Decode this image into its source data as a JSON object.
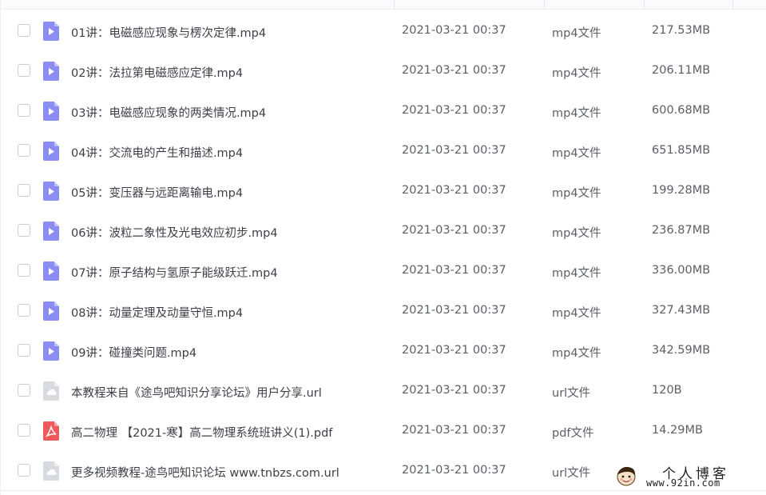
{
  "files": [
    {
      "name": "01讲：电磁感应现象与楞次定律.mp4",
      "date": "2021-03-21 00:37",
      "type": "mp4文件",
      "size": "217.53MB",
      "icon": "video-file-icon"
    },
    {
      "name": "02讲：法拉第电磁感应定律.mp4",
      "date": "2021-03-21 00:37",
      "type": "mp4文件",
      "size": "206.11MB",
      "icon": "video-file-icon"
    },
    {
      "name": "03讲：电磁感应现象的两类情况.mp4",
      "date": "2021-03-21 00:37",
      "type": "mp4文件",
      "size": "600.68MB",
      "icon": "video-file-icon"
    },
    {
      "name": "04讲：交流电的产生和描述.mp4",
      "date": "2021-03-21 00:37",
      "type": "mp4文件",
      "size": "651.85MB",
      "icon": "video-file-icon"
    },
    {
      "name": "05讲：变压器与远距离输电.mp4",
      "date": "2021-03-21 00:37",
      "type": "mp4文件",
      "size": "199.28MB",
      "icon": "video-file-icon"
    },
    {
      "name": "06讲：波粒二象性及光电效应初步.mp4",
      "date": "2021-03-21 00:37",
      "type": "mp4文件",
      "size": "236.87MB",
      "icon": "video-file-icon"
    },
    {
      "name": "07讲：原子结构与氢原子能级跃迁.mp4",
      "date": "2021-03-21 00:37",
      "type": "mp4文件",
      "size": "336.00MB",
      "icon": "video-file-icon"
    },
    {
      "name": "08讲：动量定理及动量守恒.mp4",
      "date": "2021-03-21 00:37",
      "type": "mp4文件",
      "size": "327.43MB",
      "icon": "video-file-icon"
    },
    {
      "name": "09讲：碰撞类问题.mp4",
      "date": "2021-03-21 00:37",
      "type": "mp4文件",
      "size": "342.59MB",
      "icon": "video-file-icon"
    },
    {
      "name": "本教程来自《途鸟吧知识分享论坛》用户分享.url",
      "date": "2021-03-21 00:37",
      "type": "url文件",
      "size": "120B",
      "icon": "link-file-icon"
    },
    {
      "name": "高二物理 【2021-寒】高二物理系统班讲义(1).pdf",
      "date": "2021-03-21 00:37",
      "type": "pdf文件",
      "size": "14.29MB",
      "icon": "pdf-file-icon"
    },
    {
      "name": "更多视频教程-途鸟吧知识论坛 www.tnbzs.com.url",
      "date": "2021-03-21 00:37",
      "type": "url文件",
      "size": "",
      "icon": "link-file-icon"
    }
  ],
  "watermark": {
    "title": "个人博客",
    "url": "www.92in.com"
  },
  "colors": {
    "video": "#8b8df2",
    "pdf": "#f05a5a",
    "link": "#d7dade"
  }
}
